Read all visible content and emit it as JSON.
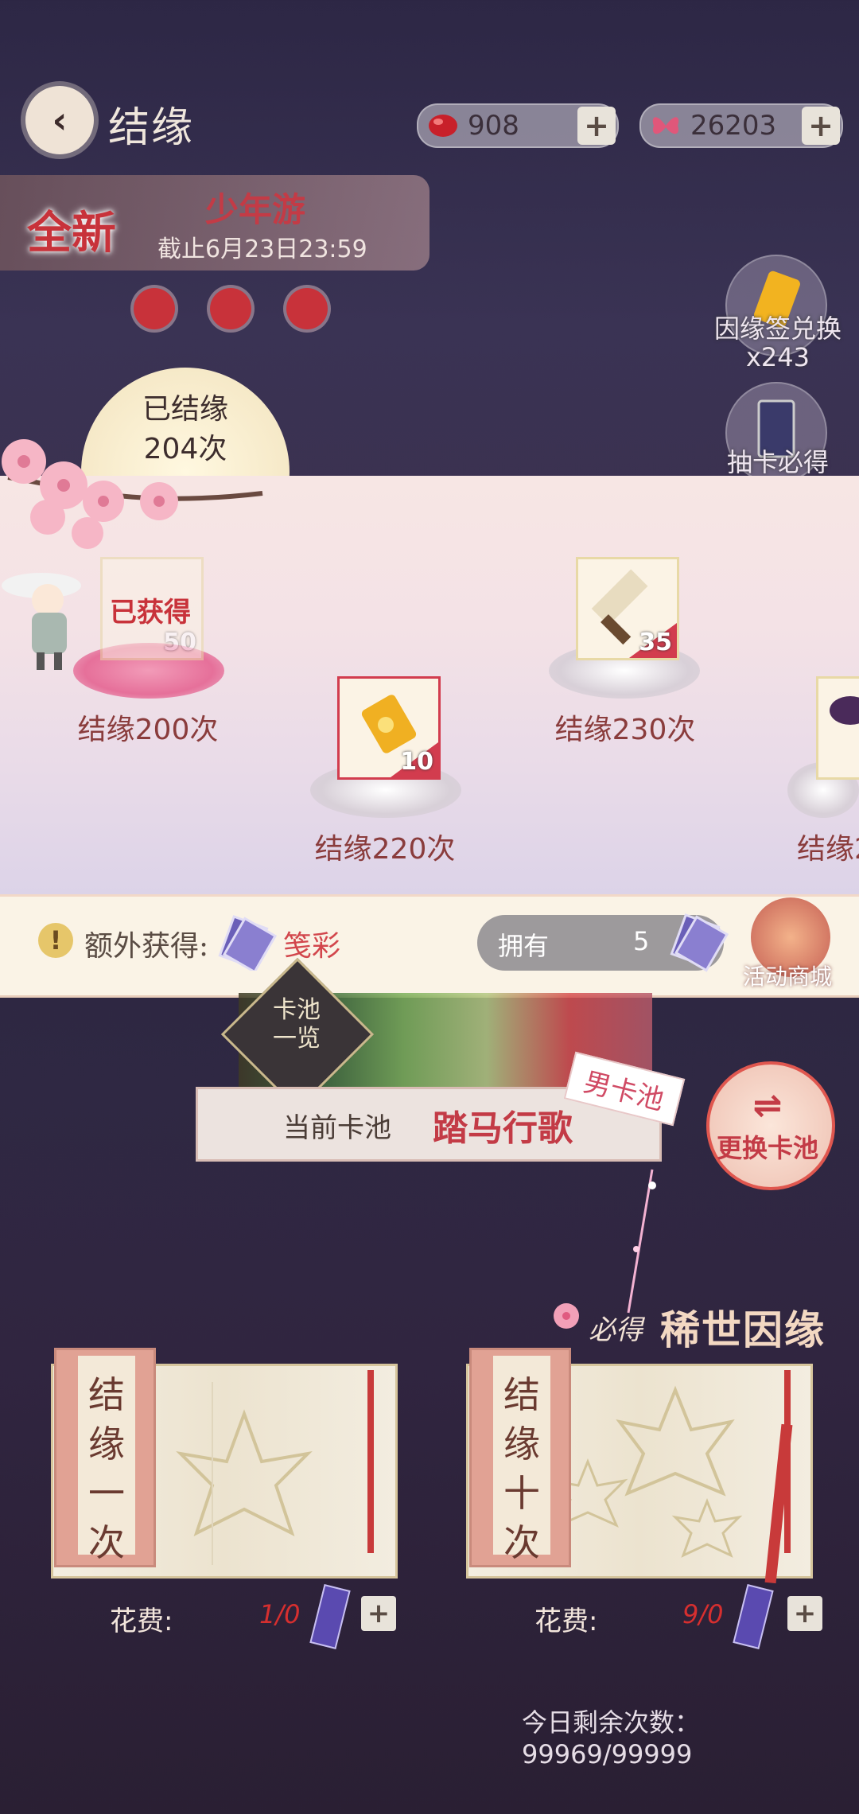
{
  "header": {
    "title": "结缘",
    "jade": "908",
    "butterfly": "26203"
  },
  "event": {
    "new_badge": "全新",
    "name": "少年游",
    "deadline": "截止6月23日23:59"
  },
  "side": {
    "exchange_label": "因缘签兑换",
    "exchange_count": "x243",
    "guarantee_label": "抽卡必得"
  },
  "progress": {
    "text1": "已结缘",
    "text2": "204次"
  },
  "milestones": [
    {
      "label": "结缘200次",
      "count": "50",
      "status": "已获得"
    },
    {
      "label": "结缘220次",
      "count": "10"
    },
    {
      "label": "结缘230次",
      "count": "35"
    },
    {
      "label": "结缘2"
    }
  ],
  "extra": {
    "label": "额外获得:",
    "item": "笺彩",
    "owned_label": "拥有",
    "owned_value": "5",
    "shop_label": "活动商城"
  },
  "pool": {
    "list_label_1": "卡池",
    "list_label_2": "一览",
    "current_label": "当前卡池",
    "current_name": "踏马行歌",
    "tag": "男卡池",
    "switch_label": "更换卡池",
    "switch_icon": "⇌"
  },
  "guarantee": {
    "prefix": "必得",
    "rare": "稀世因缘"
  },
  "draw": {
    "single": {
      "title": [
        "结",
        "缘",
        "一",
        "次"
      ],
      "cost_label": "花费:",
      "cost": "1/0"
    },
    "ten": {
      "title": [
        "结",
        "缘",
        "十",
        "次"
      ],
      "cost_label": "花费:",
      "cost": "9/0"
    }
  },
  "daily": "今日剩余次数：99969/99999",
  "colors": {
    "accent_red": "#c33b46",
    "cream": "#faf3e6"
  }
}
